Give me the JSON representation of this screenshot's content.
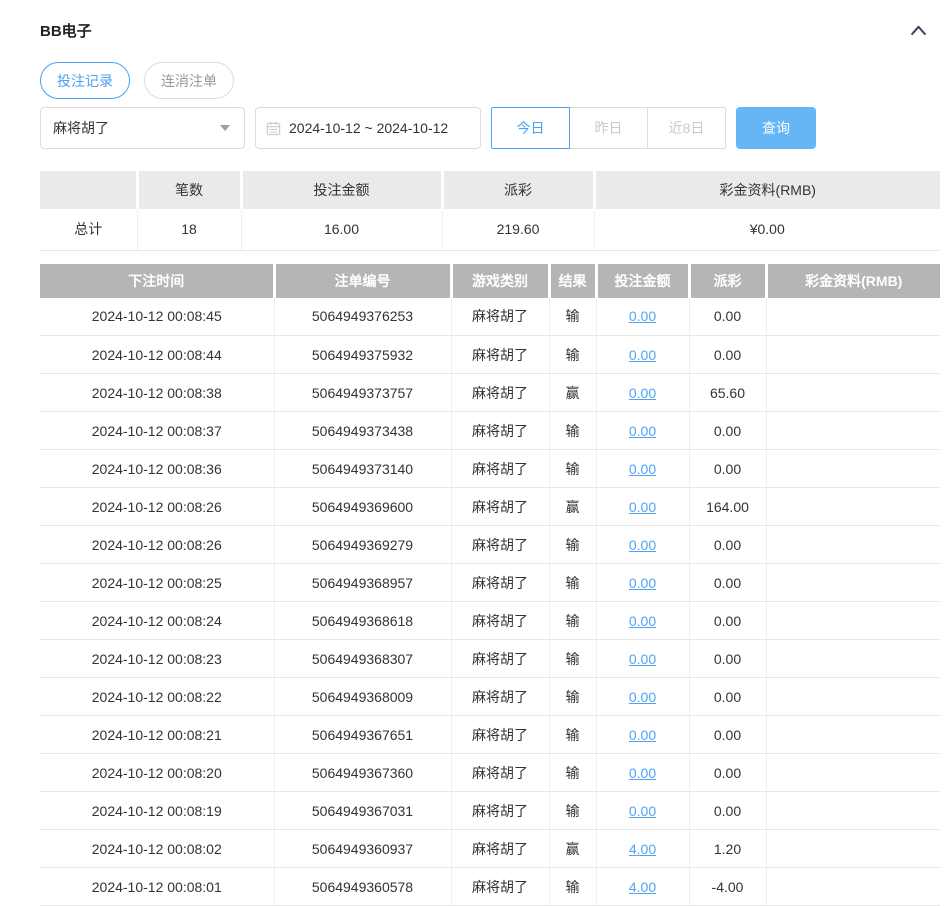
{
  "colors": {
    "accent_blue": "#4ba2f1",
    "button_blue": "#66b5f4",
    "link_blue": "#52a3f2",
    "negative_red": "#f25a5a",
    "table_header_bg": "#b5b5b5",
    "summary_header_bg": "#eaeaea"
  },
  "panel": {
    "title": "BB电子"
  },
  "icons": {
    "collapse": "chevron-up-icon",
    "date": "calendar-icon",
    "select": "chevron-down-icon"
  },
  "tabs": [
    {
      "label": "投注记录",
      "active": true
    },
    {
      "label": "连消注单",
      "active": false
    }
  ],
  "filters": {
    "game_select": {
      "value": "麻将胡了"
    },
    "date_range": {
      "value": "2024-10-12 ~ 2024-10-12"
    },
    "quick_buttons": [
      {
        "label": "今日",
        "active": true
      },
      {
        "label": "昨日",
        "active": false
      },
      {
        "label": "近8日",
        "active": false
      }
    ],
    "search_button": {
      "label": "查询"
    }
  },
  "summary": {
    "headers": [
      "",
      "笔数",
      "投注金额",
      "派彩",
      "彩金资料(RMB)"
    ],
    "row": {
      "label": "总计",
      "count": "18",
      "bet_amount": "16.00",
      "payout": "219.60",
      "bonus": "¥0.00"
    }
  },
  "table": {
    "headers": [
      "下注时间",
      "注单编号",
      "游戏类别",
      "结果",
      "投注金额",
      "派彩",
      "彩金资料(RMB)"
    ],
    "rows": [
      {
        "time": "2024-10-12 00:08:45",
        "order": "5064949376253",
        "game": "麻将胡了",
        "result": "输",
        "bet": "0.00",
        "payout": "0.00",
        "bonus": ""
      },
      {
        "time": "2024-10-12 00:08:44",
        "order": "5064949375932",
        "game": "麻将胡了",
        "result": "输",
        "bet": "0.00",
        "payout": "0.00",
        "bonus": ""
      },
      {
        "time": "2024-10-12 00:08:38",
        "order": "5064949373757",
        "game": "麻将胡了",
        "result": "赢",
        "bet": "0.00",
        "payout": "65.60",
        "bonus": ""
      },
      {
        "time": "2024-10-12 00:08:37",
        "order": "5064949373438",
        "game": "麻将胡了",
        "result": "输",
        "bet": "0.00",
        "payout": "0.00",
        "bonus": ""
      },
      {
        "time": "2024-10-12 00:08:36",
        "order": "5064949373140",
        "game": "麻将胡了",
        "result": "输",
        "bet": "0.00",
        "payout": "0.00",
        "bonus": ""
      },
      {
        "time": "2024-10-12 00:08:26",
        "order": "5064949369600",
        "game": "麻将胡了",
        "result": "赢",
        "bet": "0.00",
        "payout": "164.00",
        "bonus": ""
      },
      {
        "time": "2024-10-12 00:08:26",
        "order": "5064949369279",
        "game": "麻将胡了",
        "result": "输",
        "bet": "0.00",
        "payout": "0.00",
        "bonus": ""
      },
      {
        "time": "2024-10-12 00:08:25",
        "order": "5064949368957",
        "game": "麻将胡了",
        "result": "输",
        "bet": "0.00",
        "payout": "0.00",
        "bonus": ""
      },
      {
        "time": "2024-10-12 00:08:24",
        "order": "5064949368618",
        "game": "麻将胡了",
        "result": "输",
        "bet": "0.00",
        "payout": "0.00",
        "bonus": ""
      },
      {
        "time": "2024-10-12 00:08:23",
        "order": "5064949368307",
        "game": "麻将胡了",
        "result": "输",
        "bet": "0.00",
        "payout": "0.00",
        "bonus": ""
      },
      {
        "time": "2024-10-12 00:08:22",
        "order": "5064949368009",
        "game": "麻将胡了",
        "result": "输",
        "bet": "0.00",
        "payout": "0.00",
        "bonus": ""
      },
      {
        "time": "2024-10-12 00:08:21",
        "order": "5064949367651",
        "game": "麻将胡了",
        "result": "输",
        "bet": "0.00",
        "payout": "0.00",
        "bonus": ""
      },
      {
        "time": "2024-10-12 00:08:20",
        "order": "5064949367360",
        "game": "麻将胡了",
        "result": "输",
        "bet": "0.00",
        "payout": "0.00",
        "bonus": ""
      },
      {
        "time": "2024-10-12 00:08:19",
        "order": "5064949367031",
        "game": "麻将胡了",
        "result": "输",
        "bet": "0.00",
        "payout": "0.00",
        "bonus": ""
      },
      {
        "time": "2024-10-12 00:08:02",
        "order": "5064949360937",
        "game": "麻将胡了",
        "result": "赢",
        "bet": "4.00",
        "payout": "1.20",
        "bonus": ""
      },
      {
        "time": "2024-10-12 00:08:01",
        "order": "5064949360578",
        "game": "麻将胡了",
        "result": "输",
        "bet": "4.00",
        "payout": "-4.00",
        "bonus": ""
      }
    ]
  }
}
